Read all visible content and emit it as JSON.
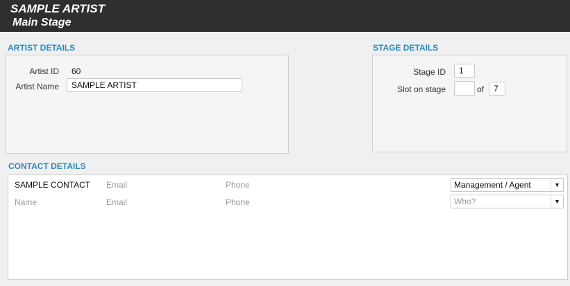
{
  "header": {
    "artist_name": "SAMPLE ARTIST",
    "stage_name": "Main Stage"
  },
  "artist_details": {
    "title": "ARTIST DETAILS",
    "artist_id_label": "Artist ID",
    "artist_id_value": "60",
    "artist_name_label": "Artist Name",
    "artist_name_value": "SAMPLE ARTIST"
  },
  "stage_details": {
    "title": "STAGE DETAILS",
    "stage_id_label": "Stage ID",
    "stage_id_value": "1",
    "slot_label": "Slot on stage",
    "slot_value": "",
    "of_label": "of",
    "slot_total": "7"
  },
  "contact_details": {
    "title": "CONTACT DETAILS",
    "rows": [
      {
        "name": "SAMPLE CONTACT",
        "email": "Email",
        "phone": "Phone",
        "role": "Management / Agent"
      },
      {
        "name": "Name",
        "email": "Email",
        "phone": "Phone",
        "role": "Who?"
      }
    ]
  },
  "icons": {
    "dropdown_caret": "▼"
  }
}
